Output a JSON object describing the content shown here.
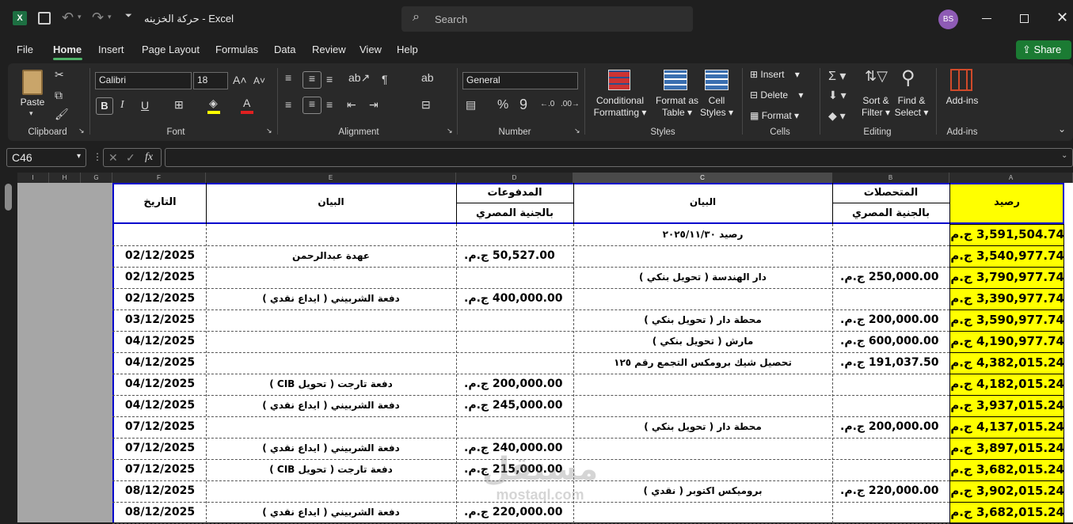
{
  "titlebar": {
    "app_icon": "excel-icon",
    "filename": "حركة الخزينه",
    "separator": "-",
    "app": "Excel",
    "search_placeholder": "Search",
    "avatar_initials": "BS"
  },
  "menu": {
    "items": [
      "File",
      "Home",
      "Insert",
      "Page Layout",
      "Formulas",
      "Data",
      "Review",
      "View",
      "Help"
    ],
    "active": "Home",
    "share": "Share"
  },
  "ribbon": {
    "clipboard": {
      "label": "Clipboard",
      "paste": "Paste"
    },
    "font": {
      "label": "Font",
      "name": "Calibri",
      "size": "18",
      "bold": "B",
      "italic": "I",
      "underline": "U"
    },
    "alignment": {
      "label": "Alignment"
    },
    "number": {
      "label": "Number",
      "format": "General",
      "percent": "%",
      "comma": "9"
    },
    "styles": {
      "label": "Styles",
      "conditional": "Conditional",
      "formatting": "Formatting",
      "format_as": "Format as",
      "table": "Table",
      "cell": "Cell",
      "cell_styles": "Styles"
    },
    "cells": {
      "label": "Cells",
      "insert": "Insert",
      "delete": "Delete",
      "format": "Format"
    },
    "editing": {
      "label": "Editing",
      "sort": "Sort &",
      "filter": "Filter",
      "find": "Find &",
      "select": "Select"
    },
    "addins": {
      "label": "Add-ins",
      "addins_btn": "Add-ins"
    }
  },
  "formula_bar": {
    "name_box": "C46",
    "fx": "fx",
    "content": ""
  },
  "columns": [
    "I",
    "H",
    "G",
    "F",
    "E",
    "D",
    "C",
    "B",
    "A"
  ],
  "headers": {
    "date": "التاريخ",
    "desc_left": "البيان",
    "payments": "المدفوعات",
    "payments_sub": "بالجنية المصري",
    "desc_right": "البيان",
    "receipts": "المتحصلات",
    "receipts_sub": "بالجنية المصري",
    "balance": "رصيد"
  },
  "rows": [
    {
      "date": "",
      "desc_left": "",
      "payment": "",
      "desc_right": "رصيد ٢٠٢٥/١١/٣٠",
      "receipt": "",
      "balance": "3,591,504.74 ج.م."
    },
    {
      "date": "02/12/2025",
      "desc_left": "عهدة عبدالرحمن",
      "payment": "50,527.00 ج.م.",
      "desc_right": "",
      "receipt": "",
      "balance": "3,540,977.74 ج.م."
    },
    {
      "date": "02/12/2025",
      "desc_left": "",
      "payment": "",
      "desc_right": "دار الهندسة ( تحويل بنكي )",
      "receipt": "250,000.00 ج.م.",
      "balance": "3,790,977.74 ج.م."
    },
    {
      "date": "02/12/2025",
      "desc_left": "دفعة الشربيني ( ايداع نقدي )",
      "payment": "400,000.00 ج.م.",
      "desc_right": "",
      "receipt": "",
      "balance": "3,390,977.74 ج.م."
    },
    {
      "date": "03/12/2025",
      "desc_left": "",
      "payment": "",
      "desc_right": "محطة دار ( تحويل بنكي )",
      "receipt": "200,000.00 ج.م.",
      "balance": "3,590,977.74 ج.م."
    },
    {
      "date": "04/12/2025",
      "desc_left": "",
      "payment": "",
      "desc_right": "مارش ( تحويل بنكي )",
      "receipt": "600,000.00 ج.م.",
      "balance": "4,190,977.74 ج.م."
    },
    {
      "date": "04/12/2025",
      "desc_left": "",
      "payment": "",
      "desc_right": "تحصيل شيك برومكس التجمع رقم ١٢٥",
      "receipt": "191,037.50 ج.م.",
      "balance": "4,382,015.24 ج.م."
    },
    {
      "date": "04/12/2025",
      "desc_left": "دفعة تارجت ( تحويل CIB )",
      "payment": "200,000.00 ج.م.",
      "desc_right": "",
      "receipt": "",
      "balance": "4,182,015.24 ج.م."
    },
    {
      "date": "04/12/2025",
      "desc_left": "دفعة الشربيني ( ايداع نقدي )",
      "payment": "245,000.00 ج.م.",
      "desc_right": "",
      "receipt": "",
      "balance": "3,937,015.24 ج.م."
    },
    {
      "date": "07/12/2025",
      "desc_left": "",
      "payment": "",
      "desc_right": "محطة دار ( تحويل بنكي )",
      "receipt": "200,000.00 ج.م.",
      "balance": "4,137,015.24 ج.م."
    },
    {
      "date": "07/12/2025",
      "desc_left": "دفعة الشربيني ( ايداع نقدي )",
      "payment": "240,000.00 ج.م.",
      "desc_right": "",
      "receipt": "",
      "balance": "3,897,015.24 ج.م."
    },
    {
      "date": "07/12/2025",
      "desc_left": "دفعة تارجت ( تحويل CIB )",
      "payment": "215,000.00 ج.م.",
      "desc_right": "",
      "receipt": "",
      "balance": "3,682,015.24 ج.م."
    },
    {
      "date": "08/12/2025",
      "desc_left": "",
      "payment": "",
      "desc_right": "بروميكس اكتوبر ( نقدي )",
      "receipt": "220,000.00 ج.م.",
      "balance": "3,902,015.24 ج.م."
    },
    {
      "date": "08/12/2025",
      "desc_left": "دفعة الشربيني ( ايداع نقدي )",
      "payment": "220,000.00 ج.م.",
      "desc_right": "",
      "receipt": "",
      "balance": "3,682,015.24 ج.م."
    }
  ],
  "watermark": {
    "main": "مستقل",
    "url": "mostaql.com"
  },
  "colors": {
    "highlight": "#ffff00",
    "header_border": "#0000cc",
    "accent": "#2e7d32",
    "avatar": "#8e5bb5"
  }
}
